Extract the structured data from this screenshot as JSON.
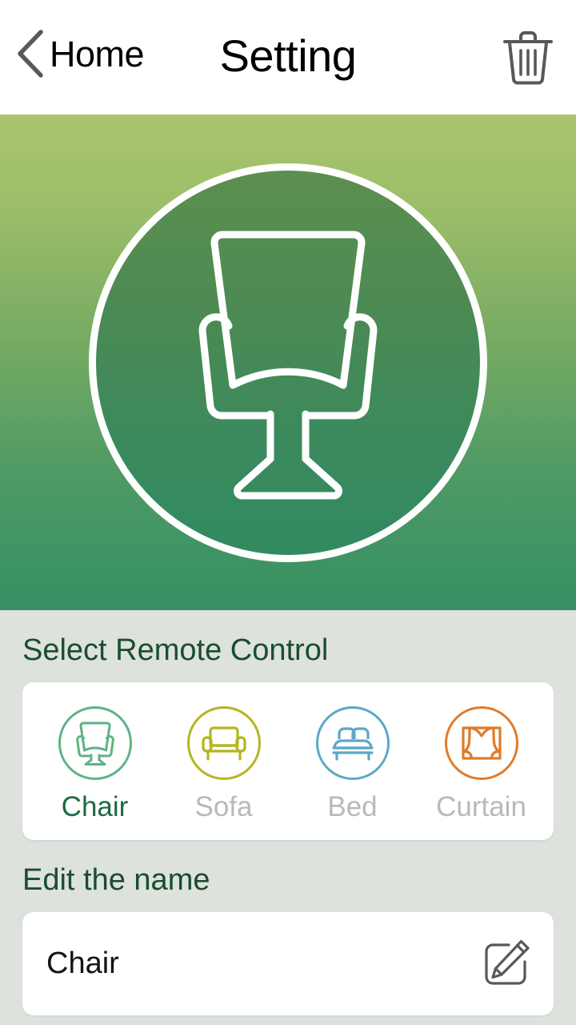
{
  "header": {
    "back_label": "Home",
    "title": "Setting",
    "back_icon": "chevron-left-icon",
    "delete_icon": "trash-icon"
  },
  "hero": {
    "icon": "armchair-icon",
    "gradient_top": "#aac46d",
    "gradient_bottom": "#359063",
    "circle_border": "#ffffff"
  },
  "sections": {
    "remote_title": "Select Remote Control",
    "name_title": "Edit the name"
  },
  "remotes": [
    {
      "label": "Chair",
      "icon": "armchair-icon",
      "color": "#5fb383",
      "selected": true
    },
    {
      "label": "Sofa",
      "icon": "sofa-icon",
      "color": "#b5b520",
      "selected": false
    },
    {
      "label": "Bed",
      "icon": "bed-icon",
      "color": "#5ca8c6",
      "selected": false
    },
    {
      "label": "Curtain",
      "icon": "curtain-icon",
      "color": "#e07b28",
      "selected": false
    }
  ],
  "name_field": {
    "value": "Chair",
    "placeholder": "Chair",
    "edit_icon": "pencil-edit-icon"
  },
  "colors": {
    "page_background": "#dde2dc",
    "card_background": "#ffffff",
    "section_title": "#1a4d2e",
    "selected_label": "#1c6b3f",
    "unselected_label": "#b6bbb6",
    "header_text": "#000000",
    "icon_gray": "#555555"
  }
}
